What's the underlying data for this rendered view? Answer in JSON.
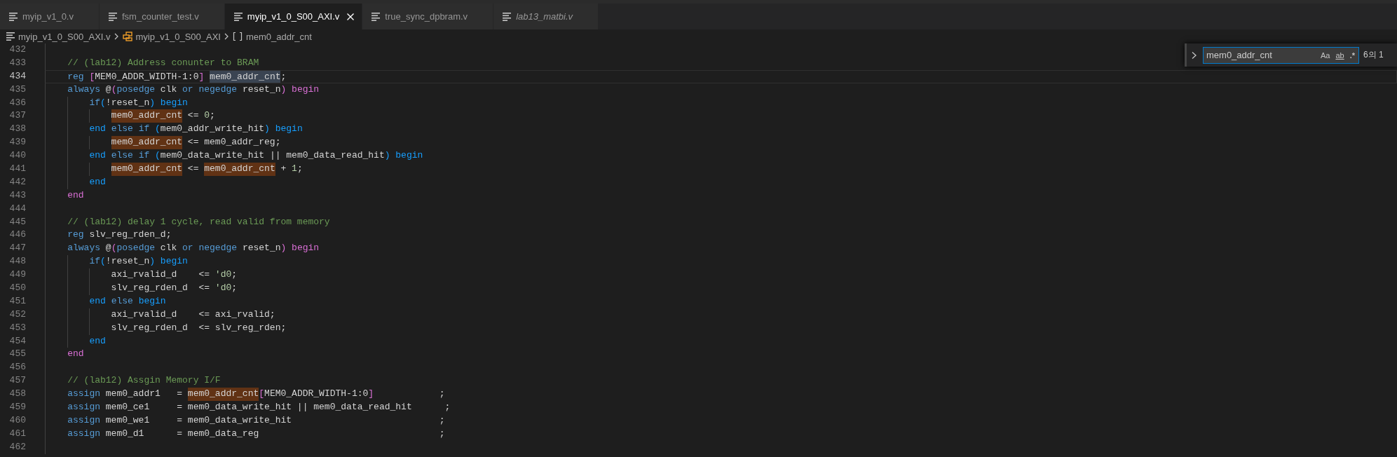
{
  "tabs": [
    {
      "label": "myip_v1_0.v",
      "selected": false,
      "preview": false
    },
    {
      "label": "fsm_counter_test.v",
      "selected": false,
      "preview": false
    },
    {
      "label": "myip_v1_0_S00_AXI.v",
      "selected": true,
      "preview": false
    },
    {
      "label": "true_sync_dpbram.v",
      "selected": false,
      "preview": false
    },
    {
      "label": "lab13_matbi.v",
      "selected": false,
      "preview": true
    }
  ],
  "breadcrumb": [
    {
      "label": "myip_v1_0_S00_AXI.v",
      "kind": "file"
    },
    {
      "label": "myip_v1_0_S00_AXI",
      "kind": "module"
    },
    {
      "label": "mem0_addr_cnt",
      "kind": "variable"
    }
  ],
  "editor": {
    "lines": [
      {
        "number": "432",
        "current": false
      },
      {
        "number": "433",
        "current": false,
        "tokens": [
          {
            "text": "    // (lab12) Address conunter to BRAM",
            "kind": "comment"
          }
        ]
      },
      {
        "number": "434",
        "current": true,
        "tokens": [
          {
            "text": "    reg ",
            "kind": "keyword"
          },
          {
            "text": "[",
            "kind": "bracket"
          },
          {
            "text": "MEM0_ADDR_WIDTH-1:0",
            "kind": "plain"
          },
          {
            "text": "] ",
            "kind": "bracket"
          },
          {
            "text": "mem0_addr_cnt",
            "kind": "selection"
          },
          {
            "text": ";",
            "kind": "plain"
          }
        ]
      },
      {
        "number": "435",
        "current": false,
        "tokens": [
          {
            "text": "    always",
            "kind": "keyword"
          },
          {
            "text": " @",
            "kind": "plain"
          },
          {
            "text": "(",
            "kind": "bracket"
          },
          {
            "text": "posedge",
            "kind": "keyword"
          },
          {
            "text": " clk ",
            "kind": "plain"
          },
          {
            "text": "or negedge",
            "kind": "keyword"
          },
          {
            "text": " reset_n",
            "kind": "plain"
          },
          {
            "text": ") begin",
            "kind": "bracket"
          }
        ]
      },
      {
        "number": "436",
        "current": false,
        "tokens": [
          {
            "text": "        if",
            "kind": "keyword"
          },
          {
            "text": "(",
            "kind": "nested"
          },
          {
            "text": "!reset_n",
            "kind": "plain"
          },
          {
            "text": ") begin",
            "kind": "nested"
          }
        ]
      },
      {
        "number": "437",
        "current": false,
        "tokens": [
          {
            "text": "            mem0_addr_cnt",
            "kind": "match"
          },
          {
            "text": " <= ",
            "kind": "plain"
          },
          {
            "text": "0",
            "kind": "number"
          },
          {
            "text": ";",
            "kind": "plain"
          }
        ]
      },
      {
        "number": "438",
        "current": false,
        "tokens": [
          {
            "text": "        end ",
            "kind": "nested"
          },
          {
            "text": "else if ",
            "kind": "keyword"
          },
          {
            "text": "(",
            "kind": "nested"
          },
          {
            "text": "mem0_addr_write_hit",
            "kind": "plain"
          },
          {
            "text": ") begin",
            "kind": "nested"
          }
        ]
      },
      {
        "number": "439",
        "current": false,
        "tokens": [
          {
            "text": "            mem0_addr_cnt",
            "kind": "match"
          },
          {
            "text": " <= mem0_addr_reg;",
            "kind": "plain"
          }
        ]
      },
      {
        "number": "440",
        "current": false,
        "tokens": [
          {
            "text": "        end ",
            "kind": "nested"
          },
          {
            "text": "else if ",
            "kind": "keyword"
          },
          {
            "text": "(",
            "kind": "nested"
          },
          {
            "text": "mem0_data_write_hit || mem0_data_read_hit",
            "kind": "plain"
          },
          {
            "text": ") begin",
            "kind": "nested"
          }
        ]
      },
      {
        "number": "441",
        "current": false,
        "tokens": [
          {
            "text": "            mem0_addr_cnt",
            "kind": "match"
          },
          {
            "text": " <= ",
            "kind": "plain"
          },
          {
            "text": "mem0_addr_cnt",
            "kind": "match"
          },
          {
            "text": " + ",
            "kind": "plain"
          },
          {
            "text": "1",
            "kind": "number"
          },
          {
            "text": ";",
            "kind": "plain"
          }
        ]
      },
      {
        "number": "442",
        "current": false,
        "tokens": [
          {
            "text": "        end",
            "kind": "nested"
          }
        ]
      },
      {
        "number": "443",
        "current": false,
        "tokens": [
          {
            "text": "    end",
            "kind": "bracket"
          }
        ]
      },
      {
        "number": "444",
        "current": false
      },
      {
        "number": "445",
        "current": false,
        "tokens": [
          {
            "text": "    // (lab12) delay 1 cycle, read valid from memory",
            "kind": "comment"
          }
        ]
      },
      {
        "number": "446",
        "current": false,
        "tokens": [
          {
            "text": "    reg",
            "kind": "keyword"
          },
          {
            "text": " slv_reg_rden_d;",
            "kind": "plain"
          }
        ]
      },
      {
        "number": "447",
        "current": false,
        "tokens": [
          {
            "text": "    always",
            "kind": "keyword"
          },
          {
            "text": " @",
            "kind": "plain"
          },
          {
            "text": "(",
            "kind": "bracket"
          },
          {
            "text": "posedge",
            "kind": "keyword"
          },
          {
            "text": " clk ",
            "kind": "plain"
          },
          {
            "text": "or negedge",
            "kind": "keyword"
          },
          {
            "text": " reset_n",
            "kind": "plain"
          },
          {
            "text": ") begin",
            "kind": "bracket"
          }
        ]
      },
      {
        "number": "448",
        "current": false,
        "tokens": [
          {
            "text": "        if",
            "kind": "keyword"
          },
          {
            "text": "(",
            "kind": "nested"
          },
          {
            "text": "!reset_n",
            "kind": "plain"
          },
          {
            "text": ") begin",
            "kind": "nested"
          }
        ]
      },
      {
        "number": "449",
        "current": false,
        "tokens": [
          {
            "text": "            axi_rvalid_d    <= ",
            "kind": "plain"
          },
          {
            "text": "'d0",
            "kind": "number"
          },
          {
            "text": ";",
            "kind": "plain"
          }
        ]
      },
      {
        "number": "450",
        "current": false,
        "tokens": [
          {
            "text": "            slv_reg_rden_d  <= ",
            "kind": "plain"
          },
          {
            "text": "'d0",
            "kind": "number"
          },
          {
            "text": ";",
            "kind": "plain"
          }
        ]
      },
      {
        "number": "451",
        "current": false,
        "tokens": [
          {
            "text": "        end ",
            "kind": "nested"
          },
          {
            "text": "else ",
            "kind": "keyword"
          },
          {
            "text": "begin",
            "kind": "nested"
          }
        ]
      },
      {
        "number": "452",
        "current": false,
        "tokens": [
          {
            "text": "            axi_rvalid_d    <= axi_rvalid;",
            "kind": "plain"
          }
        ]
      },
      {
        "number": "453",
        "current": false,
        "tokens": [
          {
            "text": "            slv_reg_rden_d  <= slv_reg_rden;",
            "kind": "plain"
          }
        ]
      },
      {
        "number": "454",
        "current": false,
        "tokens": [
          {
            "text": "        end",
            "kind": "nested"
          }
        ]
      },
      {
        "number": "455",
        "current": false,
        "tokens": [
          {
            "text": "    end",
            "kind": "bracket"
          }
        ]
      },
      {
        "number": "456",
        "current": false
      },
      {
        "number": "457",
        "current": false,
        "tokens": [
          {
            "text": "    // (lab12) Assgin Memory I/F",
            "kind": "comment"
          }
        ]
      },
      {
        "number": "458",
        "current": false,
        "tokens": [
          {
            "text": "    assign",
            "kind": "keyword"
          },
          {
            "text": " mem0_addr1   = ",
            "kind": "plain"
          },
          {
            "text": "mem0_addr_cnt",
            "kind": "match"
          },
          {
            "text": "[",
            "kind": "bracket"
          },
          {
            "text": "MEM0_ADDR_WIDTH-1:0",
            "kind": "plain"
          },
          {
            "text": "]",
            "kind": "bracket"
          },
          {
            "text": "            ;",
            "kind": "plain"
          }
        ]
      },
      {
        "number": "459",
        "current": false,
        "tokens": [
          {
            "text": "    assign",
            "kind": "keyword"
          },
          {
            "text": " mem0_ce1     = mem0_data_write_hit || mem0_data_read_hit      ;",
            "kind": "plain"
          }
        ]
      },
      {
        "number": "460",
        "current": false,
        "tokens": [
          {
            "text": "    assign",
            "kind": "keyword"
          },
          {
            "text": " mem0_we1     = mem0_data_write_hit                           ;",
            "kind": "plain"
          }
        ]
      },
      {
        "number": "461",
        "current": false,
        "tokens": [
          {
            "text": "    assign",
            "kind": "keyword"
          },
          {
            "text": " mem0_d1      = mem0_data_reg                                 ;",
            "kind": "plain"
          }
        ]
      },
      {
        "number": "462",
        "current": false
      }
    ]
  },
  "find_widget": {
    "value": "mem0_addr_cnt",
    "options": [
      "Aa",
      "ab",
      ".*"
    ],
    "count": "6의 1"
  }
}
